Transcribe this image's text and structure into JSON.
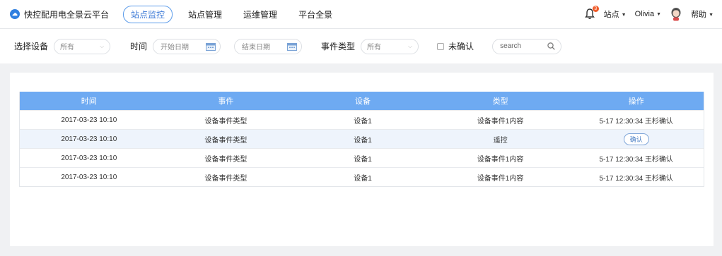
{
  "app": {
    "title": "快控配用电全景云平台"
  },
  "nav": [
    {
      "label": "站点监控",
      "active": true
    },
    {
      "label": "站点管理"
    },
    {
      "label": "运维管理"
    },
    {
      "label": "平台全景"
    }
  ],
  "header_right": {
    "bell_count": "3",
    "site_menu": "站点",
    "user_menu": "Olivia",
    "help_menu": "帮助"
  },
  "filters": {
    "device_label": "选择设备",
    "device_value": "所有",
    "time_label": "时间",
    "start_placeholder": "开始日期",
    "end_placeholder": "结束日期",
    "event_type_label": "事件类型",
    "event_type_value": "所有",
    "unconfirmed_label": "未确认",
    "search_placeholder": "search"
  },
  "table": {
    "columns": [
      "时间",
      "事件",
      "设备",
      "类型",
      "操作"
    ],
    "rows": [
      {
        "time": "2017-03-23 10:10",
        "event": "设备事件类型",
        "device": "设备1",
        "type": "设备事件1内容",
        "action": "5-17 12:30:34 王杉确认"
      },
      {
        "time": "2017-03-23 10:10",
        "event": "设备事件类型",
        "device": "设备1",
        "type": "遥控",
        "action_button": "确认"
      },
      {
        "time": "2017-03-23 10:10",
        "event": "设备事件类型",
        "device": "设备1",
        "type": "设备事件1内容",
        "action": "5-17 12:30:34 王杉确认"
      },
      {
        "time": "2017-03-23 10:10",
        "event": "设备事件类型",
        "device": "设备1",
        "type": "设备事件1内容",
        "action": "5-17 12:30:34 王杉确认"
      }
    ]
  },
  "colors": {
    "accent": "#3a78d6",
    "table_header": "#6eaaf2",
    "row_highlight": "#eef4fc",
    "badge": "#f05a28"
  },
  "icons": [
    "cloud-logo-icon",
    "bell-icon",
    "caret-down-icon",
    "avatar-icon",
    "calendar-icon",
    "search-icon",
    "chevron-down-icon"
  ]
}
